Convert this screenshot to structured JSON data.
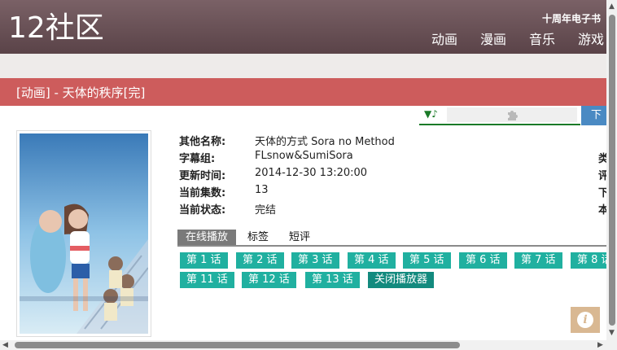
{
  "header": {
    "logo": "12社区",
    "anniversary": "十周年电子书",
    "nav": [
      "动画",
      "漫画",
      "音乐",
      "游戏"
    ]
  },
  "title_bar": {
    "text": "[动画] - 天体的秩序[完]"
  },
  "player": {
    "music_icon": "music-note-icon",
    "download_label": "下"
  },
  "info": {
    "rows": [
      {
        "label": "其他名称:",
        "value": "天体的方式 Sora no Method"
      },
      {
        "label": "字幕组:",
        "value": "FLsnow&SumiSora"
      },
      {
        "label": "更新时间:",
        "value": "2014-12-30 13:20:00"
      },
      {
        "label": "当前集数:",
        "value": "13"
      },
      {
        "label": "当前状态:",
        "value": "完结"
      }
    ],
    "side_chars": [
      "类",
      "评",
      "下",
      "本"
    ]
  },
  "tabs": [
    "在线播放",
    "标签",
    "短评"
  ],
  "episodes": {
    "row1": [
      "第 1 话",
      "第 2 话",
      "第 3 话",
      "第 4 话",
      "第 5 话",
      "第 6 话",
      "第 7 话",
      "第 8 话"
    ],
    "row2": [
      "第 11 话",
      "第 12 话",
      "第 13 话"
    ],
    "close_player": "关闭播放器"
  },
  "info_button": {
    "glyph": "i"
  },
  "colors": {
    "header": "#6b5257",
    "title_bar": "#cd5c5c",
    "episode_button": "#20b0a0",
    "close_button": "#138a7e",
    "info_button": "#d9b892"
  }
}
